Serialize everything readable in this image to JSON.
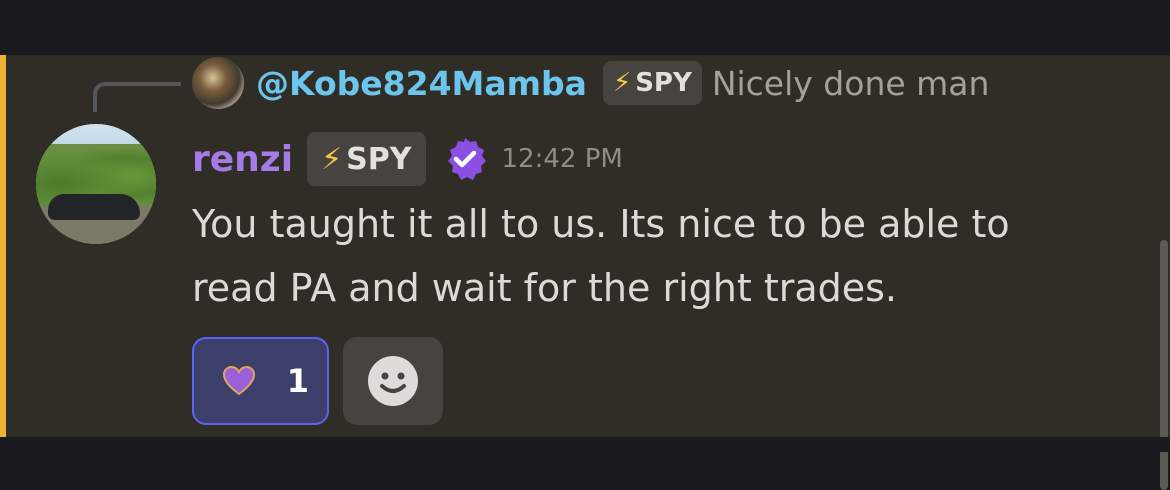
{
  "reply": {
    "username": "@Kobe824Mamba",
    "tag_icon": "⚡",
    "tag_label": "SPY",
    "text": "Nicely done man"
  },
  "message": {
    "username": "renzi",
    "tag_icon": "⚡",
    "tag_label": "SPY",
    "timestamp": "12:42 PM",
    "content": "You taught it all to us. Its nice to be able to read PA and wait for the right trades."
  },
  "reactions": [
    {
      "emoji": "purple-heart-icon",
      "count": "1"
    }
  ],
  "icons": {
    "verified": "verified-badge-icon",
    "add_reaction": "smile-face-icon"
  },
  "colors": {
    "accent": "#f0b232",
    "reply_username": "#6cc5ec",
    "username": "#a57be8",
    "reaction_border": "#5865f2"
  }
}
